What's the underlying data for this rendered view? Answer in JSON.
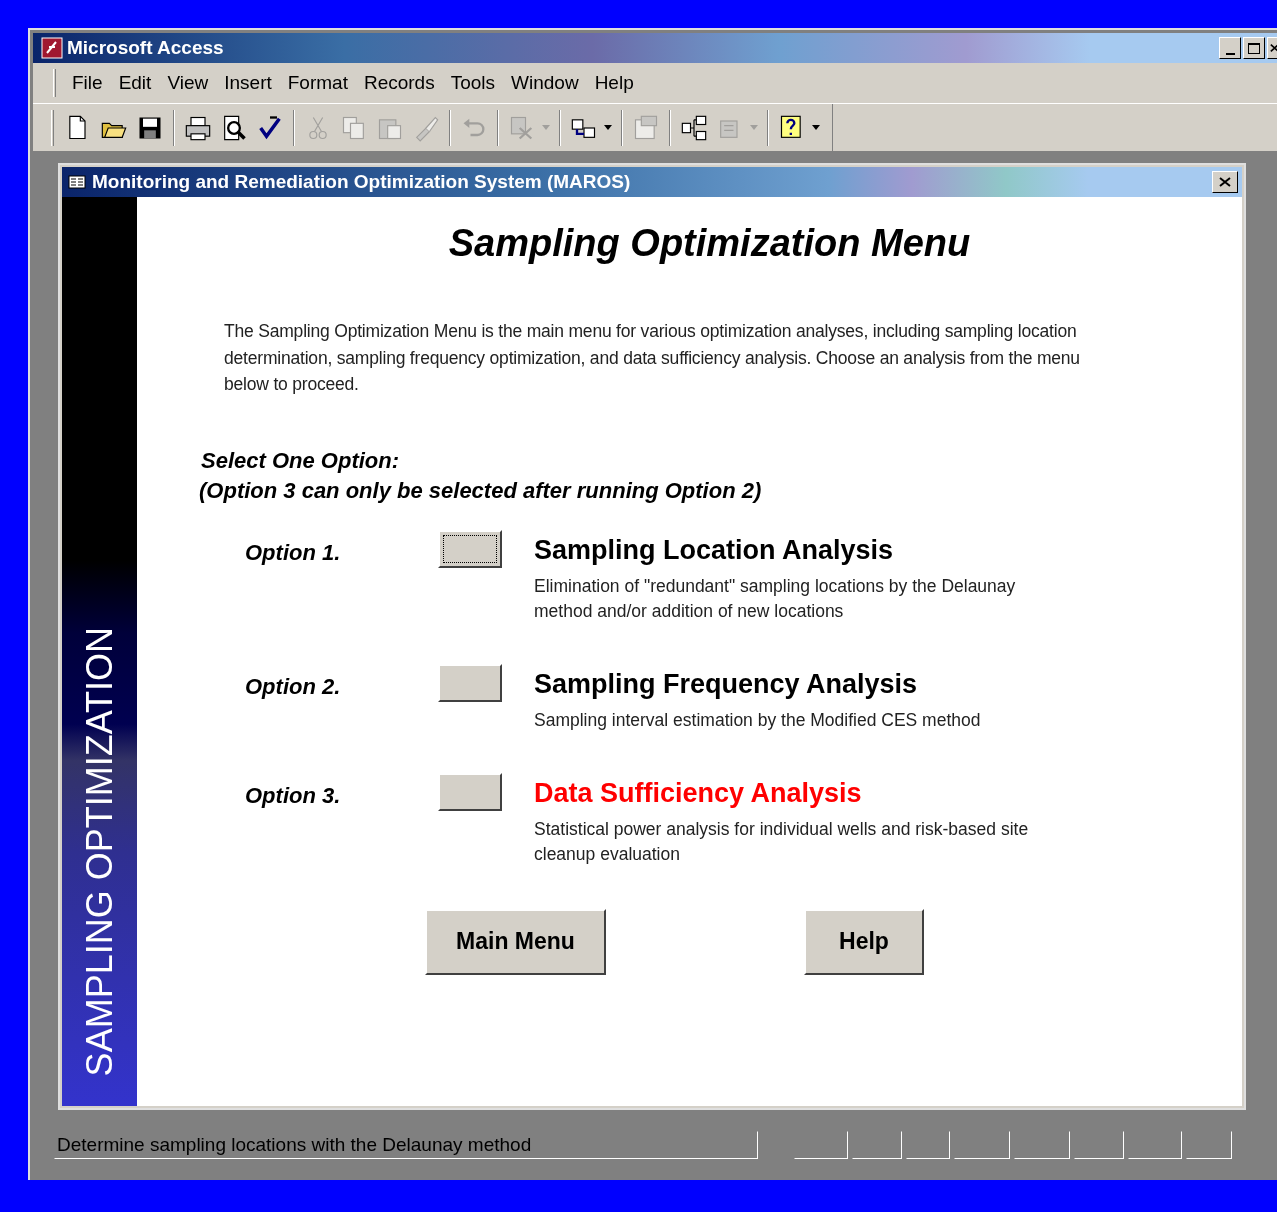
{
  "app_window": {
    "title": "Microsoft Access"
  },
  "menu": [
    "File",
    "Edit",
    "View",
    "Insert",
    "Format",
    "Records",
    "Tools",
    "Window",
    "Help"
  ],
  "toolbar_groups": [
    [
      {
        "kind": "new",
        "disabled": false,
        "dropdown": false
      },
      {
        "kind": "open",
        "disabled": false,
        "dropdown": false
      },
      {
        "kind": "save",
        "disabled": false,
        "dropdown": false
      }
    ],
    [
      {
        "kind": "print",
        "disabled": false,
        "dropdown": false
      },
      {
        "kind": "preview",
        "disabled": false,
        "dropdown": false
      },
      {
        "kind": "spelling",
        "disabled": false,
        "dropdown": false
      }
    ],
    [
      {
        "kind": "cut",
        "disabled": true,
        "dropdown": false
      },
      {
        "kind": "copy",
        "disabled": true,
        "dropdown": false
      },
      {
        "kind": "paste",
        "disabled": true,
        "dropdown": false
      },
      {
        "kind": "brush",
        "disabled": true,
        "dropdown": false
      }
    ],
    [
      {
        "kind": "undo",
        "disabled": true,
        "dropdown": false
      }
    ],
    [
      {
        "kind": "links",
        "disabled": true,
        "dropdown": true
      }
    ],
    [
      {
        "kind": "analyze",
        "disabled": false,
        "dropdown": true
      }
    ],
    [
      {
        "kind": "properties",
        "disabled": true,
        "dropdown": false
      }
    ],
    [
      {
        "kind": "relationships",
        "disabled": false,
        "dropdown": false
      },
      {
        "kind": "newobject",
        "disabled": true,
        "dropdown": true
      }
    ],
    [
      {
        "kind": "help",
        "disabled": false,
        "dropdown": true
      }
    ]
  ],
  "form_window": {
    "title": "Monitoring and Remediation Optimization System (MAROS)"
  },
  "sidebar": {
    "text": "SAMPLING OPTIMIZATION"
  },
  "heading": "Sampling Optimization Menu",
  "intro": "The Sampling Optimization Menu is the main menu for various optimization analyses, including sampling location determination, sampling frequency optimization, and data sufficiency analysis. Choose an analysis from the menu below to proceed.",
  "select_prompt": [
    "Select One Option:",
    "(Option 3 can only be selected after running Option 2)"
  ],
  "options": [
    {
      "label": "Option 1.",
      "title": "Sampling Location Analysis",
      "color": "#000000",
      "description": "Elimination of \"redundant\" sampling locations by the Delaunay method and/or addition of new locations",
      "focused": true
    },
    {
      "label": "Option 2.",
      "title": "Sampling Frequency Analysis",
      "color": "#000000",
      "description": "Sampling interval estimation by the Modified CES method",
      "focused": false
    },
    {
      "label": "Option 3.",
      "title": "Data Sufficiency Analysis",
      "color": "#ff0000",
      "description": "Statistical power analysis for individual wells and risk-based site cleanup evaluation",
      "focused": false
    }
  ],
  "buttons": [
    "Main Menu",
    "Help"
  ],
  "status_bar": {
    "text": "Determine sampling locations with the Delaunay method"
  }
}
